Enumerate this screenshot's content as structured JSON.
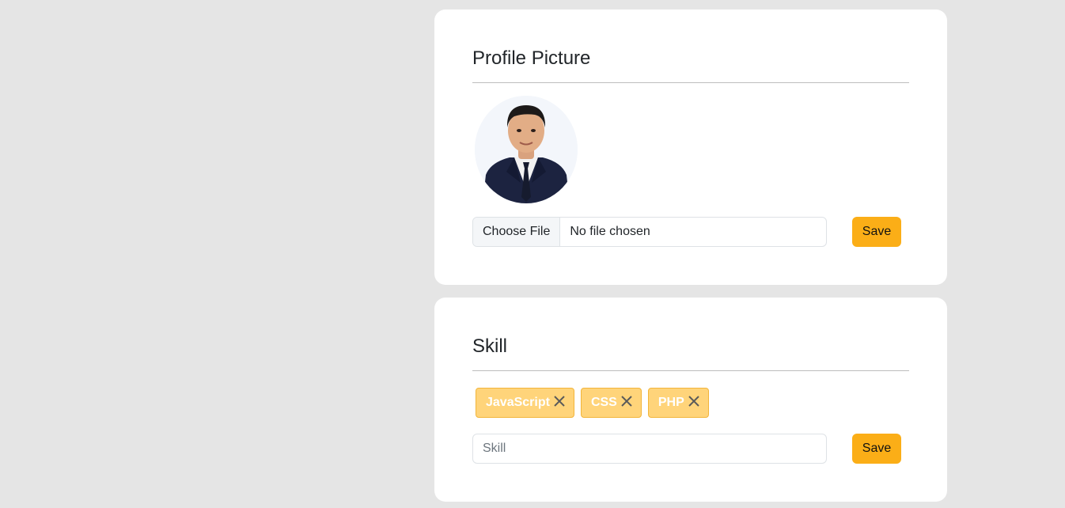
{
  "profile_card": {
    "title": "Profile Picture",
    "file_input": {
      "button_label": "Choose File",
      "status_text": "No file chosen"
    },
    "save_label": "Save"
  },
  "skill_card": {
    "title": "Skill",
    "tags": [
      {
        "label": "JavaScript",
        "remove_icon": "close-icon"
      },
      {
        "label": "CSS",
        "remove_icon": "close-icon"
      },
      {
        "label": "PHP",
        "remove_icon": "close-icon"
      }
    ],
    "input_placeholder": "Skill",
    "input_value": "",
    "save_label": "Save"
  },
  "colors": {
    "page_background": "#e5e5e5",
    "card_background": "#ffffff",
    "accent": "#fbae17",
    "tag_background": "#ffd47a",
    "tag_border": "#f2b53a"
  }
}
